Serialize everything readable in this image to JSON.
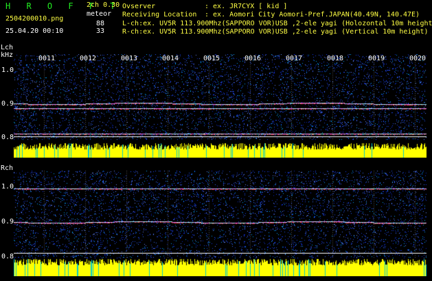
{
  "app": {
    "logo": "H R O F F T",
    "version": "2ch 0.30",
    "file_name": "2504200010.png",
    "datetime": "25.04.20 00:10",
    "meteor_label": "meteor",
    "meteor_counts": [
      "88",
      "33"
    ]
  },
  "info": {
    "observer_label": "Ovserver",
    "observer_value": ": ex. JR7CYX [ kid ]",
    "location_label": "Receiving Location",
    "location_value": ": ex. Aomori City Aomori-Pref.JAPAN(40.49N, 140.47E)",
    "lch": "L-ch:ex. UV5R 113.900Mhz(SAPPORO VOR)USB ,2-ele yagi (Holozontal 10m height)",
    "rch": "R-ch:ex. UV5R 113.900Mhz(SAPPORO VOR)USB ,2-ele yagi (Vertical 10m height)"
  },
  "panels": [
    {
      "label": "Lch",
      "unit": "kHz",
      "yticks": [
        "1.0",
        "0.9",
        "0.8"
      ]
    },
    {
      "label": "Rch",
      "unit": "",
      "yticks": [
        "1.0",
        "0.9",
        "0.8"
      ]
    }
  ],
  "time_ticks": [
    "0011",
    "0012",
    "0013",
    "0014",
    "0015",
    "0016",
    "0017",
    "0018",
    "0019",
    "0020"
  ],
  "colors": {
    "background": "#000000",
    "noise": "#1a3cff",
    "bars": "#ffff00",
    "logo": "#22ee22"
  }
}
